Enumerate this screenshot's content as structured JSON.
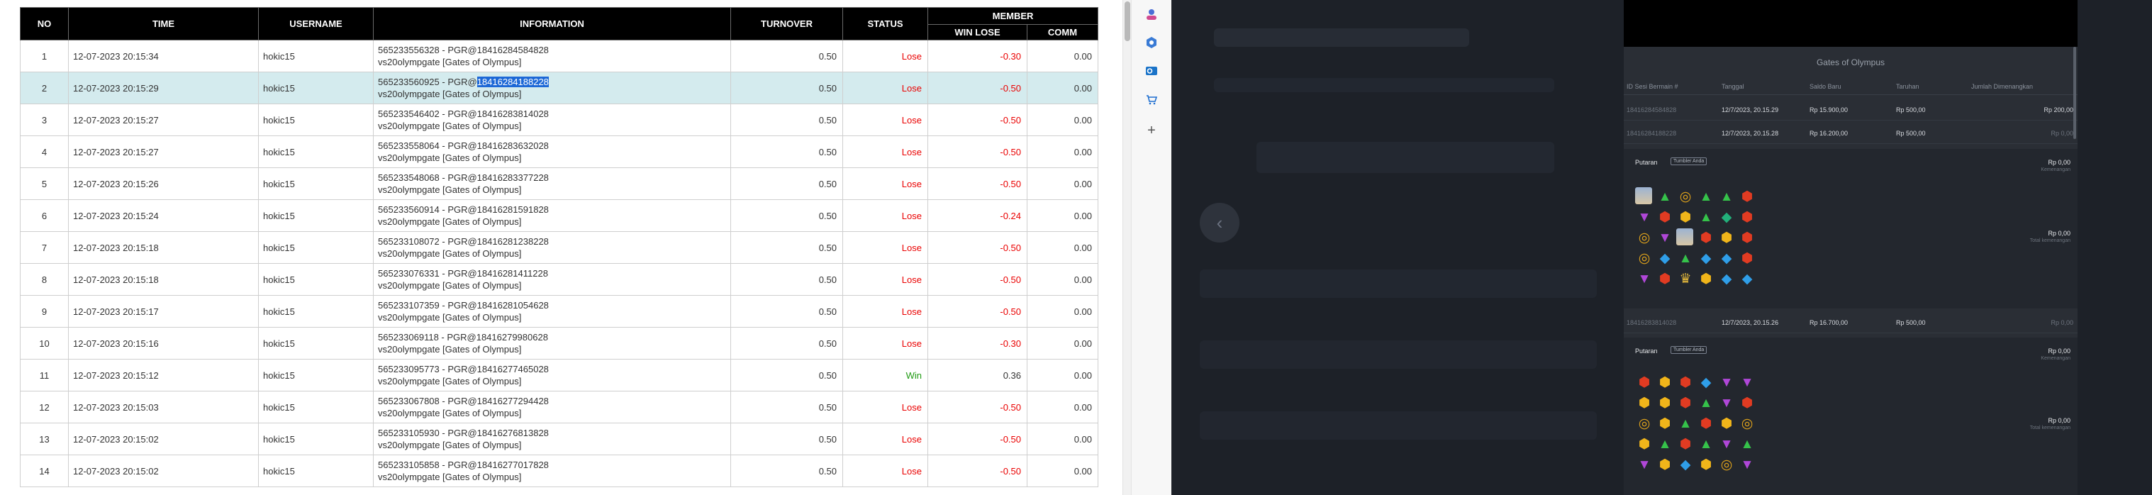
{
  "table": {
    "headers": {
      "no": "NO",
      "time": "TIME",
      "username": "USERNAME",
      "information": "INFORMATION",
      "turnover": "TURNOVER",
      "status": "STATUS",
      "member": "MEMBER",
      "win_lose": "WIN LOSE",
      "comm": "COMM"
    },
    "rows": [
      {
        "no": "1",
        "time": "12-07-2023 20:15:34",
        "username": "hokic15",
        "info1": "565233556328 - PGR@18416284584828",
        "info2": "vs20olympgate [Gates of Olympus]",
        "turnover": "0.50",
        "status": "Lose",
        "winlose": "-0.30",
        "comm": "0.00"
      },
      {
        "no": "2",
        "time": "12-07-2023 20:15:29",
        "username": "hokic15",
        "info1_pre": "565233560925 - PGR@",
        "info1_hl": "18416284188228",
        "info2": "vs20olympgate [Gates of Olympus]",
        "turnover": "0.50",
        "status": "Lose",
        "winlose": "-0.50",
        "comm": "0.00"
      },
      {
        "no": "3",
        "time": "12-07-2023 20:15:27",
        "username": "hokic15",
        "info1": "565233546402 - PGR@18416283814028",
        "info2": "vs20olympgate [Gates of Olympus]",
        "turnover": "0.50",
        "status": "Lose",
        "winlose": "-0.50",
        "comm": "0.00"
      },
      {
        "no": "4",
        "time": "12-07-2023 20:15:27",
        "username": "hokic15",
        "info1": "565233558064 - PGR@18416283632028",
        "info2": "vs20olympgate [Gates of Olympus]",
        "turnover": "0.50",
        "status": "Lose",
        "winlose": "-0.50",
        "comm": "0.00"
      },
      {
        "no": "5",
        "time": "12-07-2023 20:15:26",
        "username": "hokic15",
        "info1": "565233548068 - PGR@18416283377228",
        "info2": "vs20olympgate [Gates of Olympus]",
        "turnover": "0.50",
        "status": "Lose",
        "winlose": "-0.50",
        "comm": "0.00"
      },
      {
        "no": "6",
        "time": "12-07-2023 20:15:24",
        "username": "hokic15",
        "info1": "565233560914 - PGR@18416281591828",
        "info2": "vs20olympgate [Gates of Olympus]",
        "turnover": "0.50",
        "status": "Lose",
        "winlose": "-0.24",
        "comm": "0.00"
      },
      {
        "no": "7",
        "time": "12-07-2023 20:15:18",
        "username": "hokic15",
        "info1": "565233108072 - PGR@18416281238228",
        "info2": "vs20olympgate [Gates of Olympus]",
        "turnover": "0.50",
        "status": "Lose",
        "winlose": "-0.50",
        "comm": "0.00"
      },
      {
        "no": "8",
        "time": "12-07-2023 20:15:18",
        "username": "hokic15",
        "info1": "565233076331 - PGR@18416281411228",
        "info2": "vs20olympgate [Gates of Olympus]",
        "turnover": "0.50",
        "status": "Lose",
        "winlose": "-0.50",
        "comm": "0.00"
      },
      {
        "no": "9",
        "time": "12-07-2023 20:15:17",
        "username": "hokic15",
        "info1": "565233107359 - PGR@18416281054628",
        "info2": "vs20olympgate [Gates of Olympus]",
        "turnover": "0.50",
        "status": "Lose",
        "winlose": "-0.50",
        "comm": "0.00"
      },
      {
        "no": "10",
        "time": "12-07-2023 20:15:16",
        "username": "hokic15",
        "info1": "565233069118 - PGR@18416279980628",
        "info2": "vs20olympgate [Gates of Olympus]",
        "turnover": "0.50",
        "status": "Lose",
        "winlose": "-0.30",
        "comm": "0.00"
      },
      {
        "no": "11",
        "time": "12-07-2023 20:15:12",
        "username": "hokic15",
        "info1": "565233095773 - PGR@18416277465028",
        "info2": "vs20olympgate [Gates of Olympus]",
        "turnover": "0.50",
        "status": "Win",
        "winlose": "0.36",
        "comm": "0.00"
      },
      {
        "no": "12",
        "time": "12-07-2023 20:15:03",
        "username": "hokic15",
        "info1": "565233067808 - PGR@18416277294428",
        "info2": "vs20olympgate [Gates of Olympus]",
        "turnover": "0.50",
        "status": "Lose",
        "winlose": "-0.50",
        "comm": "0.00"
      },
      {
        "no": "13",
        "time": "12-07-2023 20:15:02",
        "username": "hokic15",
        "info1": "565233105930 - PGR@18416276813828",
        "info2": "vs20olympgate [Gates of Olympus]",
        "turnover": "0.50",
        "status": "Lose",
        "winlose": "-0.50",
        "comm": "0.00"
      },
      {
        "no": "14",
        "time": "12-07-2023 20:15:02",
        "username": "hokic15",
        "info1": "565233105858 - PGR@18416277017828",
        "info2": "vs20olympgate [Gates of Olympus]",
        "turnover": "0.50",
        "status": "Lose",
        "winlose": "-0.50",
        "comm": "0.00"
      }
    ],
    "selected_row": "2"
  },
  "sidebar_icons": [
    "person-icon",
    "copilot-icon",
    "outlook-icon",
    "shopping-icon",
    "add-icon"
  ],
  "game_panel": {
    "title": "Gates of Olympus",
    "headers": {
      "id": "ID Sesi Bermain #",
      "tanggal": "Tanggal",
      "saldo": "Saldo Baru",
      "taruhan": "Taruhan",
      "kemenangan": "Jumlah Dimenangkan"
    },
    "rows": [
      {
        "id": "18416284584828",
        "tanggal": "12/7/2023, 20.15.29",
        "saldo": "Rp 15.900,00",
        "taruhan": "Rp 500,00",
        "menang": "Rp 200,00"
      },
      {
        "id": "18416284188228",
        "tanggal": "12/7/2023, 20.15.28",
        "saldo": "Rp 16.200,00",
        "taruhan": "Rp 500,00",
        "menang": "Rp 0,00"
      },
      {
        "id": "18416283814028",
        "tanggal": "12/7/2023, 20.15.26",
        "saldo": "Rp 16.700,00",
        "taruhan": "Rp 500,00",
        "menang": "Rp 0,00"
      }
    ],
    "detail1": {
      "putaran": "Putaran",
      "badge": "Tumbler Anda",
      "amount_top": "Rp 0,00",
      "label_top": "Kemenangan",
      "amount_bottom": "Rp 0,00",
      "label_bottom": "Total kemenangan"
    },
    "detail2": {
      "putaran": "Putaran",
      "badge": "Tumbler Anda",
      "amount_top": "Rp 0,00",
      "label_top": "Kemenangan",
      "amount_bottom": "Rp 0,00",
      "label_bottom": "Total kemenangan"
    }
  },
  "colors": {
    "header_bg": "#000000",
    "selected_row_bg": "#d4ebee",
    "lose": "#ea0000",
    "win": "#1f9a12",
    "highlight": "#1d68d6",
    "dark_bg": "#1d2128"
  }
}
